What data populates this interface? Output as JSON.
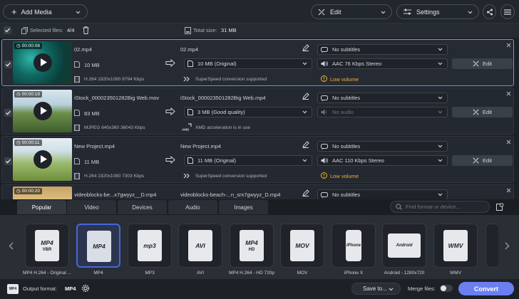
{
  "toolbar": {
    "add_media": "Add Media",
    "edit": "Edit",
    "settings": "Settings"
  },
  "selection": {
    "selected_label": "Selected files:",
    "selected_value": "4/4",
    "total_label": "Total size:",
    "total_value": "31 MB"
  },
  "files": [
    {
      "duration": "00:00:08",
      "name": "02.mp4",
      "size": "10 MB",
      "codec": "H.264 1920x1080 9794 Kbps",
      "out_name": "02.mp4",
      "out_size": "10 MB (Original)",
      "accel": "SuperSpeed conversion supported",
      "subtitles": "No subtitles",
      "audio": "AAC 76 Kbps Stereo",
      "warning": "Low volume",
      "edit": "Edit"
    },
    {
      "duration": "00:00:19",
      "name": "iStock_000023501282Big Web.mov",
      "size": "83 MB",
      "codec": "MJPEG 640x360 36043 Kbps",
      "out_name": "iStock_000023501282Big Web.mp4",
      "out_size": "3 MB (Good quality)",
      "accel": "AMD acceleration is in use",
      "subtitles": "No subtitles",
      "audio": "No audio",
      "warning": "",
      "edit": "Edit"
    },
    {
      "duration": "00:00:11",
      "name": "New Project.mp4",
      "size": "11 MB",
      "codec": "H.264 1920x1080 7303 Kbps",
      "out_name": "New Project.mp4",
      "out_size": "11 MB (Original)",
      "accel": "SuperSpeed conversion supported",
      "subtitles": "No subtitles",
      "audio": "AAC 110 Kbps Stereo",
      "warning": "Low volume",
      "edit": "Edit"
    },
    {
      "duration": "00:00:20",
      "name": "videoblocks-be...x7gwyyz__D.mp4",
      "out_name": "videoblocks-beach-...n_srx7gwyyz_D.mp4",
      "subtitles": "No subtitles"
    }
  ],
  "tabs": [
    "Popular",
    "Video",
    "Devices",
    "Audio",
    "Images"
  ],
  "search_placeholder": "Find format or device...",
  "formats": [
    {
      "icon": "MP4",
      "sub": "VBR",
      "label": "MP4 H.264 - Original ..."
    },
    {
      "icon": "MP4",
      "sub": "",
      "label": "MP4"
    },
    {
      "icon": "mp3",
      "sub": "",
      "label": "MP3"
    },
    {
      "icon": "AVI",
      "sub": "",
      "label": "AVI"
    },
    {
      "icon": "MP4",
      "sub": "HD",
      "label": "MP4 H.264 - HD 720p"
    },
    {
      "icon": "MOV",
      "sub": "",
      "label": "MOV"
    },
    {
      "icon": "iPhone",
      "sub": "",
      "label": "iPhone X"
    },
    {
      "icon": "Android",
      "sub": "",
      "label": "Android - 1280x720"
    },
    {
      "icon": "WMV",
      "sub": "",
      "label": "WMV"
    }
  ],
  "bottom": {
    "output_label": "Output format:",
    "output_value": "MP4",
    "save_to": "Save to...",
    "merge_label": "Merge files:",
    "convert": "Convert"
  },
  "colors": {
    "accent": "#4a66d8",
    "warning": "#f0b429",
    "convert": "#6b7ff0"
  }
}
